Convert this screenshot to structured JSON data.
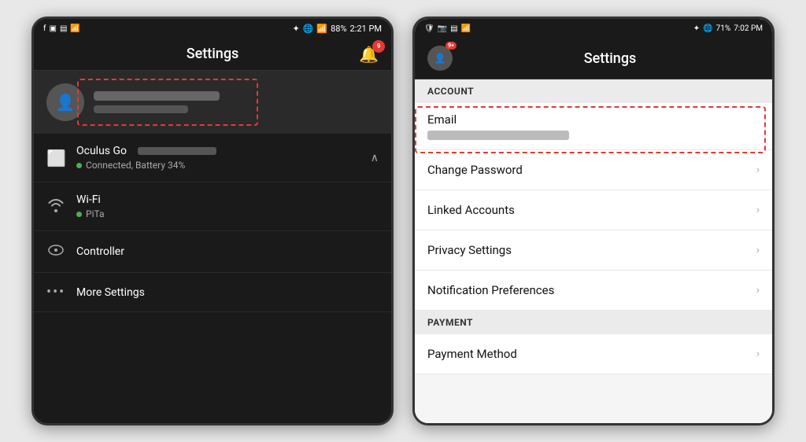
{
  "leftPhone": {
    "statusBar": {
      "leftIcons": [
        "📘",
        "📷",
        "🔊",
        "📶"
      ],
      "bluetooth": "✦",
      "wifi": "WiFi",
      "battery": "88%",
      "time": "2:21 PM"
    },
    "header": {
      "title": "Settings",
      "bellBadge": "9"
    },
    "deviceSection": {
      "deviceName": "Oculus Go",
      "deviceStatus": "Connected, Battery 34%",
      "wifi": {
        "network": "Wi-Fi",
        "ssid": "PiTa"
      },
      "controller": "Controller",
      "moreSettings": "More Settings"
    }
  },
  "rightPhone": {
    "statusBar": {
      "leftIcons": [
        "📡",
        "📷",
        "🔊",
        "📶"
      ],
      "bluetooth": "✦",
      "wifi": "WiFi",
      "battery": "71%",
      "time": "7:02 PM"
    },
    "header": {
      "title": "Settings",
      "appBadge": "9+"
    },
    "sections": [
      {
        "sectionTitle": "ACCOUNT",
        "items": [
          {
            "type": "email",
            "label": "Email",
            "isBlurred": true
          },
          {
            "type": "nav",
            "label": "Change Password"
          },
          {
            "type": "nav",
            "label": "Linked Accounts"
          },
          {
            "type": "nav",
            "label": "Privacy Settings"
          },
          {
            "type": "nav",
            "label": "Notification Preferences"
          }
        ]
      },
      {
        "sectionTitle": "PAYMENT",
        "items": [
          {
            "type": "nav",
            "label": "Payment Method"
          }
        ]
      }
    ]
  }
}
